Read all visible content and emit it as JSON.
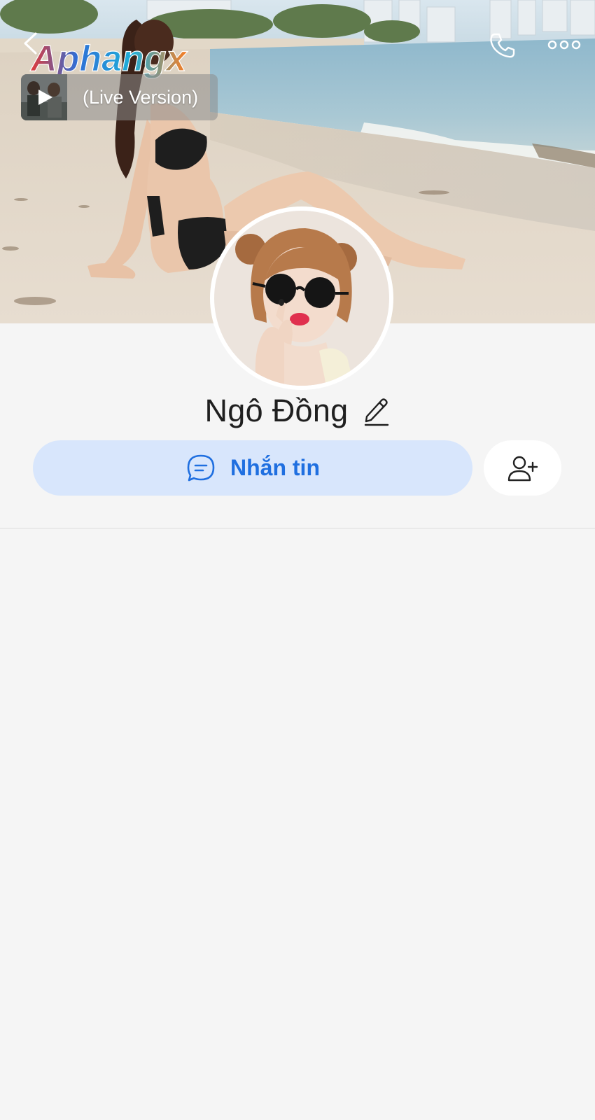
{
  "header": {
    "back_icon": "chevron-left-icon",
    "call_icon": "phone-icon",
    "more_icon": "more-horizontal-icon"
  },
  "watermark": {
    "text": "Aphangx"
  },
  "music": {
    "title": "(Live Version)",
    "play_icon": "play-icon"
  },
  "profile": {
    "name": "Ngô Đồng",
    "edit_icon": "pencil-icon"
  },
  "actions": {
    "message_label": "Nhắn tin",
    "message_icon": "chat-bubble-icon",
    "add_friend_icon": "add-user-icon"
  },
  "colors": {
    "accent": "#1f6fe0",
    "message_button_bg": "#d8e6fc",
    "page_bg": "#f5f5f5",
    "name_text": "#1f1f1f"
  }
}
